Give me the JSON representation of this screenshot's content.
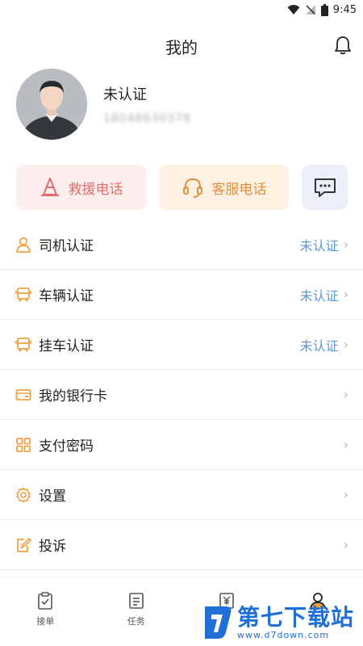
{
  "status_bar": {
    "time": "9:45"
  },
  "header": {
    "title": "我的"
  },
  "profile": {
    "status": "未认证",
    "phone": "18048630378"
  },
  "quick_actions": {
    "rescue_label": "救援电话",
    "service_label": "客服电话"
  },
  "menu": {
    "items": [
      {
        "label": "司机认证",
        "value": "未认证",
        "icon": "driver-icon"
      },
      {
        "label": "车辆认证",
        "value": "未认证",
        "icon": "vehicle-icon"
      },
      {
        "label": "挂车认证",
        "value": "未认证",
        "icon": "trailer-icon"
      },
      {
        "label": "我的银行卡",
        "value": "",
        "icon": "bank-card-icon"
      },
      {
        "label": "支付密码",
        "value": "",
        "icon": "password-grid-icon"
      },
      {
        "label": "设置",
        "value": "",
        "icon": "gear-icon"
      },
      {
        "label": "投诉",
        "value": "",
        "icon": "complaint-icon"
      }
    ]
  },
  "tabbar": {
    "tabs": [
      {
        "label": "接单",
        "icon": "clipboard-check-icon"
      },
      {
        "label": "任务",
        "icon": "list-icon"
      },
      {
        "label": "",
        "icon": "yen-receipt-icon"
      },
      {
        "label": "",
        "icon": "user-icon"
      }
    ]
  },
  "watermark": {
    "main": "第七下载站",
    "sub": "www.d7down.com"
  },
  "colors": {
    "accent_orange": "#f0a040",
    "link_blue": "#5b9bd5",
    "rescue_red": "#e56b6b"
  }
}
